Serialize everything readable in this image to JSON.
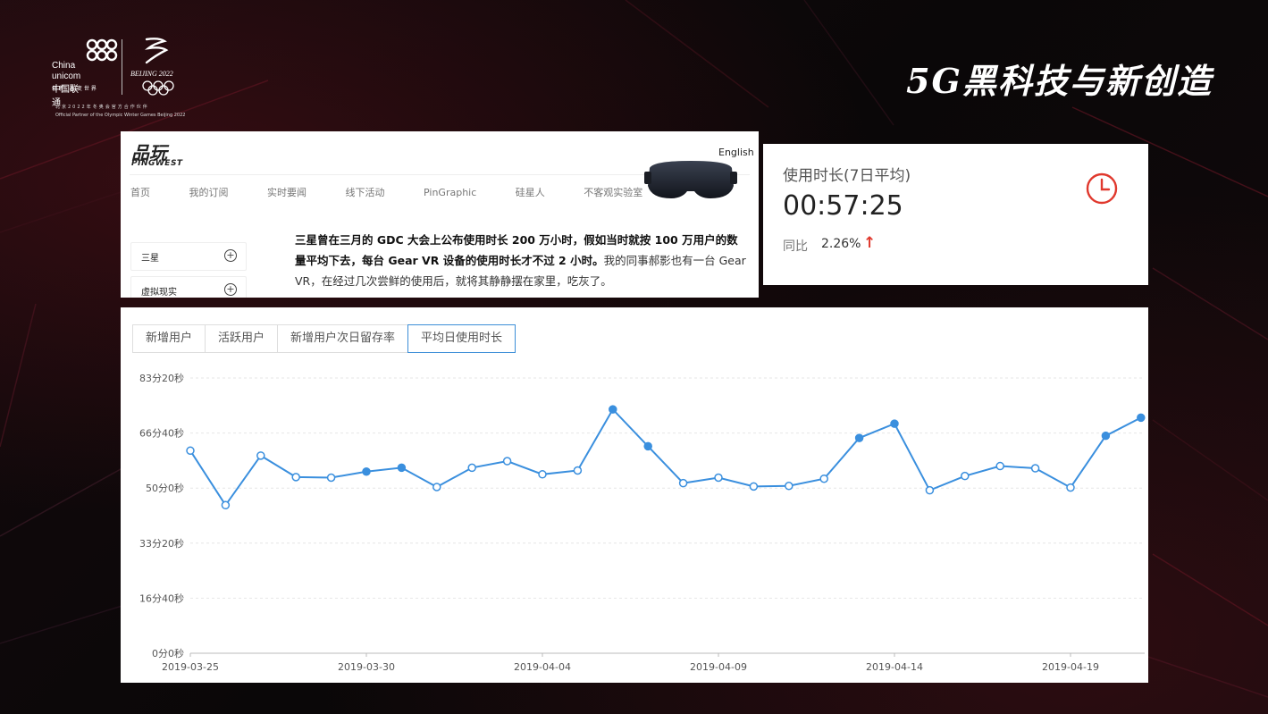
{
  "slide": {
    "title": "5G黑科技与新创造"
  },
  "logo": {
    "china": "China",
    "unicom": "unicom中国联通",
    "slogan": "创新·改变世界",
    "beijing": "BEIJING 2022",
    "partner_cn": "北京2022年冬奥会官方合作伙伴",
    "partner_en": "Official Partner of the Olympic Winter Games Beijing 2022"
  },
  "article": {
    "brand": "品玩",
    "brand_en": "PINGWEST",
    "lang": "English",
    "nav": [
      "首页",
      "我的订阅",
      "实时要闻",
      "线下活动",
      "PinGraphic",
      "硅星人",
      "不客观实验室"
    ],
    "side_items": [
      "三星",
      "虚拟现实"
    ],
    "body_bold": "三星曾在三月的 GDC 大会上公布使用时长 200 万小时，假如当时就按 100 万用户的数量平均下去，每台 Gear VR 设备的使用时长才不过 2 小时。",
    "body_rest": "我的同事郝影也有一台 Gear VR，在经过几次尝鲜的使用后，就将其静静摆在家里，吃灰了。"
  },
  "metric": {
    "label": "使用时长(7日平均)",
    "value": "00:57:25",
    "compare_label": "同比",
    "compare_value": "2.26%",
    "trend": "up",
    "accent": "#e0382d",
    "icon": "clock-icon"
  },
  "tabs": [
    {
      "label": "新增用户",
      "active": false
    },
    {
      "label": "活跃用户",
      "active": false
    },
    {
      "label": "新增用户次日留存率",
      "active": false
    },
    {
      "label": "平均日使用时长",
      "active": true
    }
  ],
  "chart_data": {
    "type": "line",
    "line_color": "#3a8fde",
    "y_ticks": [
      "0分0秒",
      "16分40秒",
      "33分20秒",
      "50分0秒",
      "66分40秒",
      "83分20秒"
    ],
    "ylim": [
      0,
      5000
    ],
    "x_tick_labels": [
      "2019-03-25",
      "2019-03-30",
      "2019-04-04",
      "2019-04-09",
      "2019-04-14",
      "2019-04-19"
    ],
    "x": [
      "2019-03-25",
      "2019-03-26",
      "2019-03-27",
      "2019-03-28",
      "2019-03-29",
      "2019-03-30",
      "2019-03-31",
      "2019-04-01",
      "2019-04-02",
      "2019-04-03",
      "2019-04-04",
      "2019-04-05",
      "2019-04-06",
      "2019-04-07",
      "2019-04-08",
      "2019-04-09",
      "2019-04-10",
      "2019-04-11",
      "2019-04-12",
      "2019-04-13",
      "2019-04-14",
      "2019-04-15",
      "2019-04-16",
      "2019-04-17",
      "2019-04-18",
      "2019-04-19",
      "2019-04-20",
      "2019-04-21"
    ],
    "values": [
      3680,
      2690,
      3590,
      3200,
      3190,
      3300,
      3370,
      3020,
      3370,
      3490,
      3250,
      3320,
      4430,
      3760,
      3090,
      3190,
      3030,
      3040,
      3170,
      3910,
      4170,
      2960,
      3220,
      3400,
      3360,
      3010,
      3950,
      4280
    ],
    "filled_points": [
      5,
      6,
      12,
      13,
      19,
      20,
      26,
      27
    ],
    "grid": true
  }
}
